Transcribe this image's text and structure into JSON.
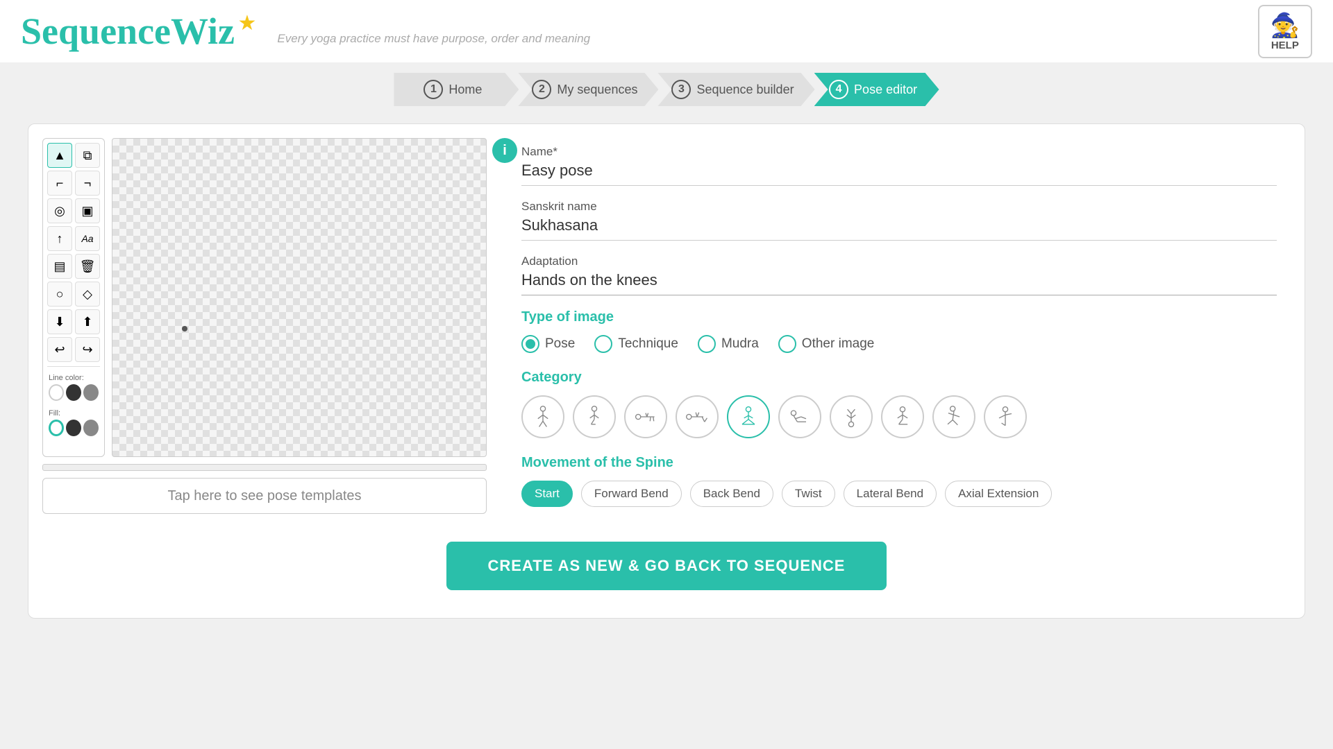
{
  "header": {
    "logo": "SequenceWiz",
    "tagline": "Every yoga practice must have purpose, order and meaning",
    "help_label": "HELP"
  },
  "breadcrumb": {
    "items": [
      {
        "num": "1",
        "label": "Home",
        "state": "inactive"
      },
      {
        "num": "2",
        "label": "My sequences",
        "state": "inactive"
      },
      {
        "num": "3",
        "label": "Sequence builder",
        "state": "inactive"
      },
      {
        "num": "4",
        "label": "Pose editor",
        "state": "active"
      }
    ]
  },
  "pose_editor": {
    "name_label": "Name*",
    "name_value": "Easy pose",
    "sanskrit_label": "Sanskrit name",
    "sanskrit_value": "Sukhasana",
    "adaptation_label": "Adaptation",
    "adaptation_value": "Hands on the knees",
    "type_of_image_label": "Type of image",
    "image_types": [
      {
        "label": "Pose",
        "selected": true
      },
      {
        "label": "Technique",
        "selected": false
      },
      {
        "label": "Mudra",
        "selected": false
      },
      {
        "label": "Other image",
        "selected": false
      }
    ],
    "category_label": "Category",
    "movement_label": "Movement of the Spine",
    "movement_chips": [
      {
        "label": "Start",
        "selected": true
      },
      {
        "label": "Forward Bend",
        "selected": false
      },
      {
        "label": "Back Bend",
        "selected": false
      },
      {
        "label": "Twist",
        "selected": false
      },
      {
        "label": "Lateral Bend",
        "selected": false
      },
      {
        "label": "Axial Extension",
        "selected": false
      }
    ]
  },
  "toolbar": {
    "line_color_label": "Line color:",
    "fill_label": "Fill:"
  },
  "template_btn_label": "Tap here to see pose templates",
  "create_btn_label": "CREATE AS NEW & GO BACK TO SEQUENCE"
}
